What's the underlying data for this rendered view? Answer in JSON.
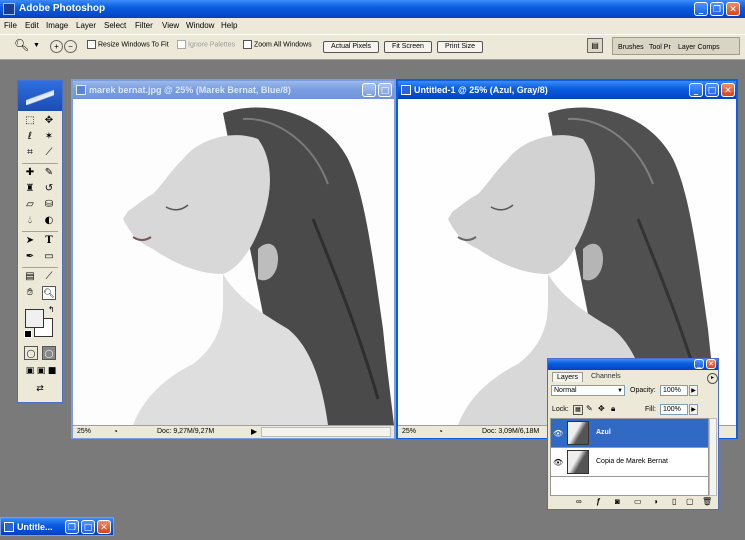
{
  "app": {
    "title": "Adobe Photoshop"
  },
  "menu": [
    {
      "label": "File"
    },
    {
      "label": "Edit"
    },
    {
      "label": "Image"
    },
    {
      "label": "Layer"
    },
    {
      "label": "Select"
    },
    {
      "label": "Filter"
    },
    {
      "label": "View"
    },
    {
      "label": "Window"
    },
    {
      "label": "Help"
    }
  ],
  "options": {
    "resize_windows": "Resize Windows To Fit",
    "ignore_palettes": "Ignore Palettes",
    "zoom_all": "Zoom All Windows",
    "actual_pixels": "Actual Pixels",
    "fit_screen": "Fit Screen",
    "print_size": "Print Size"
  },
  "palette_well": {
    "tabs": [
      "Brushes",
      "Tool Pr",
      "Layer Comps"
    ]
  },
  "doc1": {
    "title": "marek bernat.jpg @ 25% (Marek Bernat, Blue/8)",
    "zoom": "25%",
    "doc_info": "Doc: 9,27M/9,27M"
  },
  "doc2": {
    "title": "Untitled-1 @ 25% (Azul, Gray/8)",
    "zoom": "25%",
    "doc_info": "Doc: 3,09M/6,18M"
  },
  "layers_panel": {
    "tabs": [
      "Layers",
      "Channels"
    ],
    "blend_mode": "Normal",
    "opacity_label": "Opacity:",
    "opacity_value": "100%",
    "lock_label": "Lock:",
    "fill_label": "Fill:",
    "fill_value": "100%",
    "layers": [
      {
        "name": "Azul",
        "selected": true
      },
      {
        "name": "Copia de Marek Bernat",
        "selected": false
      }
    ]
  },
  "minimized": {
    "title": "Untitle..."
  },
  "colors": {
    "accent": "#316ac5",
    "xp_blue": "#0a5fe0",
    "canvas_bg": "#7a7a7a"
  }
}
